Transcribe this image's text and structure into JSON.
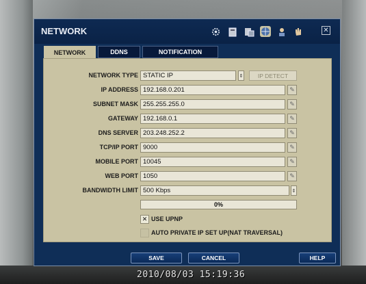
{
  "timestamp": "2010/08/03 15:19:36",
  "window": {
    "title": "NETWORK",
    "toolbar_icons": [
      "gear-icon",
      "disk-icon",
      "record-icon",
      "network-icon",
      "user-icon",
      "hand-icon",
      "close-icon"
    ]
  },
  "tabs": [
    {
      "label": "NETWORK",
      "active": true
    },
    {
      "label": "DDNS",
      "active": false
    },
    {
      "label": "NOTIFICATION",
      "active": false
    }
  ],
  "form": {
    "network_type": {
      "label": "NETWORK TYPE",
      "value": "STATIC IP"
    },
    "ip_detect_label": "IP DETECT",
    "ip_address": {
      "label": "IP ADDRESS",
      "value": "192.168.0.201"
    },
    "subnet_mask": {
      "label": "SUBNET MASK",
      "value": "255.255.255.0"
    },
    "gateway": {
      "label": "GATEWAY",
      "value": "192.168.0.1"
    },
    "dns_server": {
      "label": "DNS SERVER",
      "value": "203.248.252.2"
    },
    "tcpip_port": {
      "label": "TCP/IP PORT",
      "value": "9000"
    },
    "mobile_port": {
      "label": "MOBILE PORT",
      "value": "10045"
    },
    "web_port": {
      "label": "WEB PORT",
      "value": "1050"
    },
    "bandwidth_limit": {
      "label": "BANDWIDTH LIMIT",
      "value": "500 Kbps"
    },
    "progress": {
      "text": "0%",
      "value": 0
    },
    "use_upnp": {
      "label": "USE UPNP",
      "checked": true
    },
    "auto_private_ip": {
      "label": "AUTO PRIVATE IP SET UP(NAT TRAVERSAL)",
      "checked": false
    }
  },
  "buttons": {
    "save": "SAVE",
    "cancel": "CANCEL",
    "help": "HELP"
  },
  "colors": {
    "window_bg": "#0f2e57",
    "panel_bg": "#c9c3a3",
    "progress_fill": "#6b86b0"
  }
}
